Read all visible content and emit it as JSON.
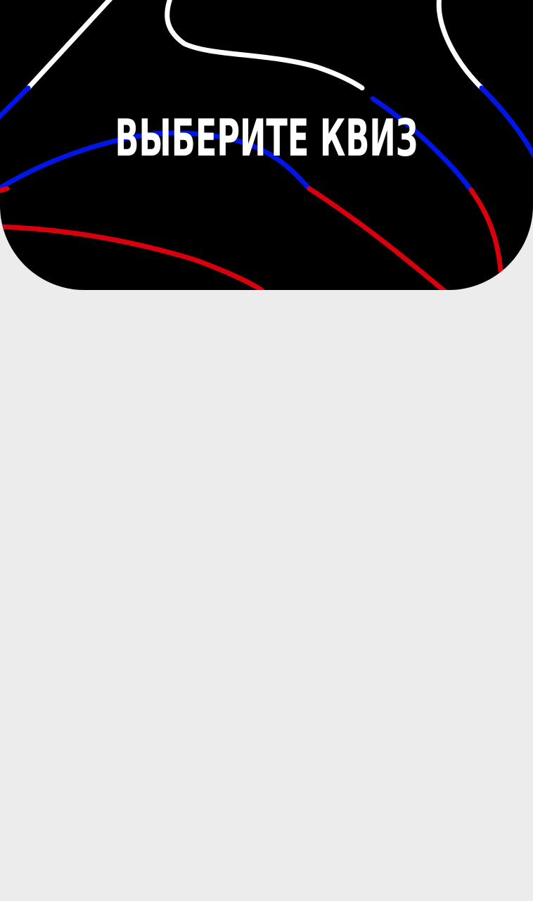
{
  "header": {
    "title": "ВЫБЕРИТЕ КВИЗ"
  },
  "colors": {
    "banner_background": "#000000",
    "page_background": "#ececec",
    "title_text": "#ffffff",
    "line_white": "#ffffff",
    "line_blue": "#0016e6",
    "line_red": "#d9000d"
  },
  "content": {
    "quiz_list": []
  }
}
